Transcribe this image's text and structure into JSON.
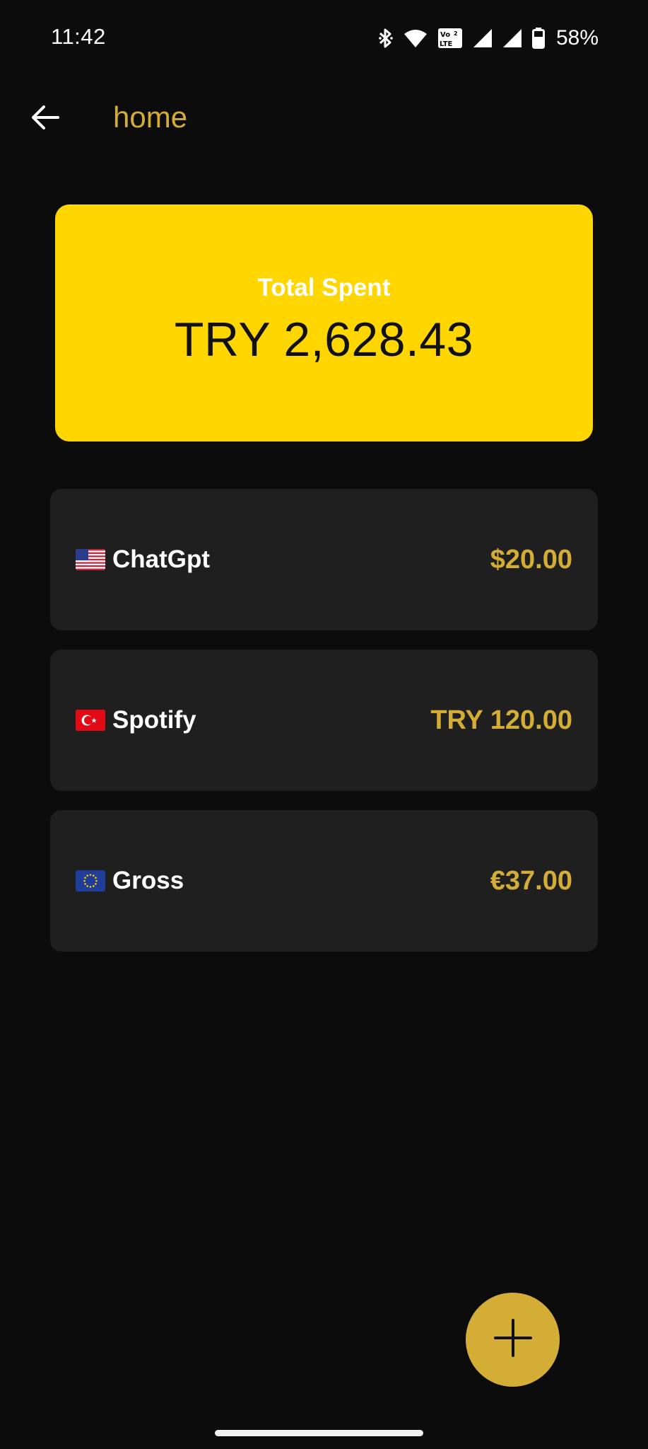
{
  "status_bar": {
    "time": "11:42",
    "battery_percent": "58%",
    "icons": [
      "bluetooth-icon",
      "wifi-icon",
      "volte-icon",
      "signal-icon",
      "signal-icon",
      "battery-icon"
    ]
  },
  "app_bar": {
    "back_icon": "arrow-left-icon",
    "title": "home"
  },
  "total_card": {
    "label": "Total Spent",
    "value": "TRY 2,628.43"
  },
  "subscriptions": [
    {
      "flag": "us-flag-icon",
      "name": "ChatGpt",
      "price": "$20.00"
    },
    {
      "flag": "tr-flag-icon",
      "name": "Spotify",
      "price": "TRY 120.00"
    },
    {
      "flag": "eu-flag-icon",
      "name": "Gross",
      "price": "€37.00"
    }
  ],
  "fab": {
    "icon": "plus-icon"
  },
  "colors": {
    "background": "#0c0c0c",
    "accent": "#d4ad36",
    "card_yellow": "#ffd600",
    "list_item": "#1f1f1f"
  }
}
